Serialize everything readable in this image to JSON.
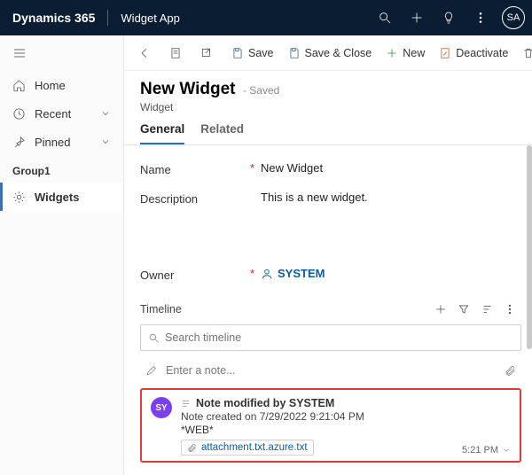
{
  "topbar": {
    "brand": "Dynamics 365",
    "app": "Widget App",
    "avatar": "SA"
  },
  "rail": {
    "home": "Home",
    "recent": "Recent",
    "pinned": "Pinned",
    "group": "Group1",
    "widgets": "Widgets"
  },
  "toolbar": {
    "save": "Save",
    "save_close": "Save & Close",
    "new": "New",
    "deactivate": "Deactivate",
    "delete": "Delete"
  },
  "header": {
    "title": "New Widget",
    "status": "- Saved",
    "entity": "Widget"
  },
  "tabs": {
    "general": "General",
    "related": "Related"
  },
  "form": {
    "name_label": "Name",
    "name_value": "New Widget",
    "desc_label": "Description",
    "desc_value": "This is a new widget.",
    "owner_label": "Owner",
    "owner_value": "SYSTEM"
  },
  "timeline": {
    "title": "Timeline",
    "search_placeholder": "Search timeline",
    "note_placeholder": "Enter a note..."
  },
  "note": {
    "avatar": "SY",
    "title": "Note modified by SYSTEM",
    "meta": "Note created on 7/29/2022 9:21:04 PM",
    "tag": "*WEB*",
    "attachment": "attachment.txt.azure.txt",
    "time": "5:21 PM"
  }
}
